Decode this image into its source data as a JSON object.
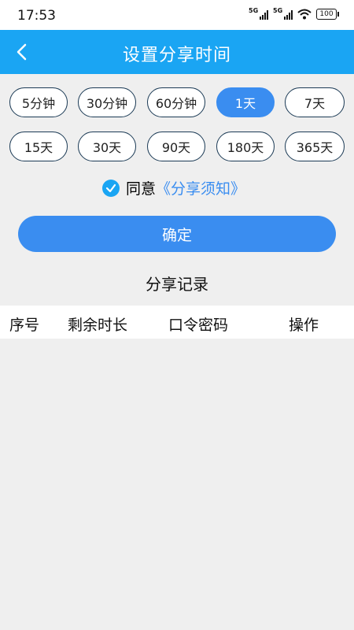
{
  "status_bar": {
    "time": "17:53",
    "network1": "5G",
    "network2": "5G",
    "battery": "100"
  },
  "header": {
    "title": "设置分享时间"
  },
  "durations": [
    "5分钟",
    "30分钟",
    "60分钟",
    "1天",
    "7天",
    "15天",
    "30天",
    "90天",
    "180天",
    "365天"
  ],
  "selected_duration": "1天",
  "agree": {
    "prefix": "同意",
    "link": "《分享须知》",
    "checked": true
  },
  "confirm_label": "确定",
  "records": {
    "title": "分享记录",
    "columns": [
      "序号",
      "剩余时长",
      "口令密码",
      "操作"
    ]
  },
  "colors": {
    "header": "#1aa5f3",
    "accent": "#3a8df0",
    "chip_border": "#1b3a55",
    "background": "#efefef"
  },
  "icons": {
    "back": "chevron-left-icon",
    "check": "check-circle-icon",
    "wifi": "wifi-icon",
    "battery": "battery-icon"
  }
}
